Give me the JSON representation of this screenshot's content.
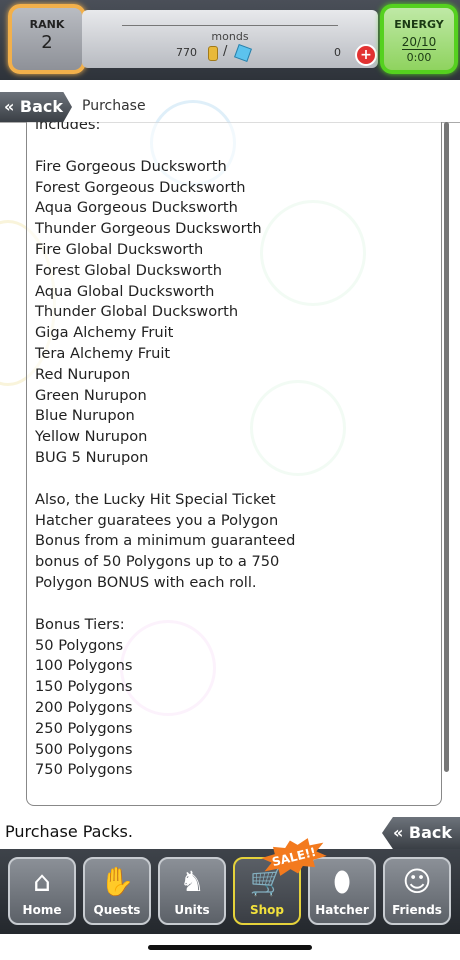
{
  "header": {
    "rank_label": "RANK",
    "rank_value": "2",
    "energy_label": "ENERGY",
    "energy_value": "20/10",
    "energy_timer": "0:00",
    "currency_title": "monds",
    "gold_value": "770",
    "gem_value": "0"
  },
  "breadcrumb": {
    "back_label": "Back",
    "page_label": "Purchase"
  },
  "content": {
    "intro": "includes:",
    "items": [
      "Fire Gorgeous Ducksworth",
      "Forest Gorgeous Ducksworth",
      "Aqua Gorgeous Ducksworth",
      "Thunder Gorgeous Ducksworth",
      "Fire Global Ducksworth",
      "Forest Global Ducksworth",
      "Aqua Global Ducksworth",
      "Thunder Global Ducksworth",
      "Giga Alchemy Fruit",
      "Tera Alchemy Fruit",
      "Red Nurupon",
      "Green Nurupon",
      "Blue Nurupon",
      "Yellow Nurupon",
      "BUG 5 Nurupon"
    ],
    "bonus_paragraph": [
      "Also, the Lucky Hit Special Ticket",
      "Hatcher guaratees you a Polygon",
      "Bonus from a minimum guaranteed",
      "bonus of 50 Polygons up to a 750",
      "Polygon BONUS with each roll."
    ],
    "tiers_title": "Bonus Tiers:",
    "tiers": [
      "50 Polygons",
      "100 Polygons",
      "150 Polygons",
      "200 Polygons",
      "250 Polygons",
      "500 Polygons",
      "750 Polygons"
    ]
  },
  "footer": {
    "packs_label": "Purchase Packs.",
    "back_label": "Back",
    "sale_badge": "SALE!!"
  },
  "nav": [
    {
      "label": "Home",
      "icon": "home-icon"
    },
    {
      "label": "Quests",
      "icon": "handshake-icon"
    },
    {
      "label": "Units",
      "icon": "rabbit-icon"
    },
    {
      "label": "Shop",
      "icon": "cart-icon"
    },
    {
      "label": "Hatcher",
      "icon": "egg-icon"
    },
    {
      "label": "Friends",
      "icon": "friends-icon"
    }
  ],
  "colors": {
    "rank_border": "#f2b04b",
    "energy_border": "#55d11f",
    "active_nav": "#f2e13c",
    "sale_badge": "#f37a1e"
  }
}
